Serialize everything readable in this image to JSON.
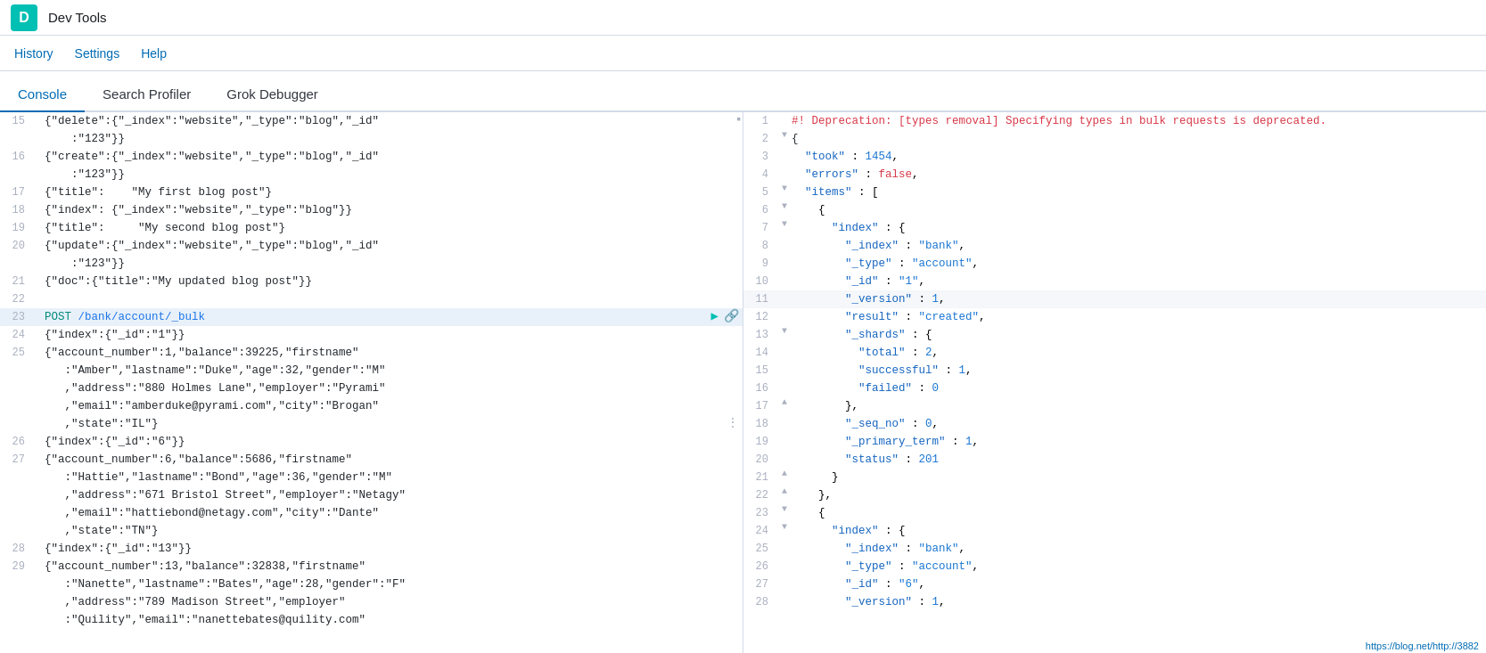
{
  "topbar": {
    "icon": "D",
    "title": "Dev Tools"
  },
  "nav": {
    "items": [
      {
        "label": "History"
      },
      {
        "label": "Settings"
      },
      {
        "label": "Help"
      }
    ]
  },
  "tabs": [
    {
      "label": "Console",
      "active": true
    },
    {
      "label": "Search Profiler",
      "active": false
    },
    {
      "label": "Grok Debugger",
      "active": false
    }
  ],
  "statusbar": {
    "url": "https://blog.net/http://3882"
  }
}
